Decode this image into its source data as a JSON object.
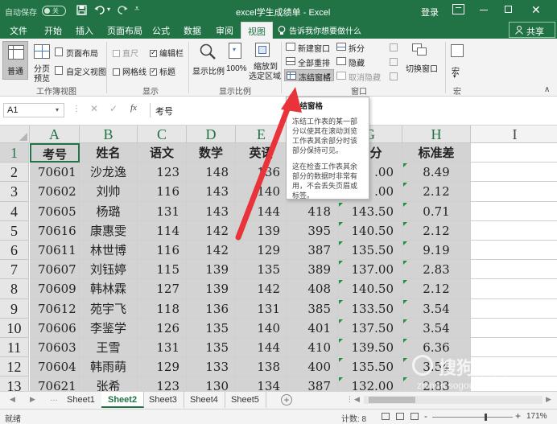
{
  "window": {
    "title": "excel学生成绩单 - Excel",
    "autosave_label": "自动保存",
    "autosave_state": "关",
    "signin_label": "登录"
  },
  "ribbon_tabs": [
    "文件",
    "开始",
    "插入",
    "页面布局",
    "公式",
    "数据",
    "审阅",
    "视图"
  ],
  "tell_me": "告诉我你想要做什么",
  "share_label": "共享",
  "ribbon": {
    "workbook_views": {
      "normal": "普通",
      "page_break_1": "分页",
      "page_break_2": "预览",
      "page_layout": "页面布局",
      "custom_views": "自定义视图",
      "group_label": "工作簿视图"
    },
    "show": {
      "ruler": "直尺",
      "formula_bar": "编辑栏",
      "gridlines": "网格线",
      "headings": "标题",
      "group_label": "显示"
    },
    "zoom": {
      "zoom": "显示比例",
      "hundred": "100%",
      "zoom_sel_1": "缩放到",
      "zoom_sel_2": "选定区域",
      "group_label": "显示比例"
    },
    "window": {
      "new_window": "新建窗口",
      "arrange_all": "全部重排",
      "freeze_panes": "冻结窗格",
      "split": "拆分",
      "hide": "隐藏",
      "unhide": "取消隐藏",
      "switch_1": "切换窗口",
      "group_label": "窗口"
    },
    "macros": {
      "label": "宏",
      "group_label": "宏"
    }
  },
  "formula_bar": {
    "name_box": "A1",
    "fx": "fx",
    "value": "考号"
  },
  "columns": [
    "A",
    "B",
    "C",
    "D",
    "E",
    "F",
    "G",
    "H",
    "I"
  ],
  "rows": [
    "1",
    "2",
    "3",
    "4",
    "5",
    "6",
    "7",
    "8",
    "9",
    "10",
    "11",
    "12",
    "13"
  ],
  "header_row": {
    "A": "考号",
    "B": "姓名",
    "C": "语文",
    "D": "数学",
    "E": "英语",
    "G": "均分",
    "H": "标准差"
  },
  "data_rows": [
    {
      "A": "70601",
      "B": "沙龙逸",
      "C": "123",
      "D": "148",
      "E": "136",
      "F": "",
      "G": ".00",
      "H": "8.49"
    },
    {
      "A": "70602",
      "B": "刘帅",
      "C": "116",
      "D": "143",
      "E": "140",
      "F": "",
      "G": ".00",
      "H": "2.12"
    },
    {
      "A": "70605",
      "B": "杨璐",
      "C": "131",
      "D": "143",
      "E": "144",
      "F": "418",
      "G": "143.50",
      "H": "0.71"
    },
    {
      "A": "70616",
      "B": "康惠雯",
      "C": "114",
      "D": "142",
      "E": "139",
      "F": "395",
      "G": "140.50",
      "H": "2.12"
    },
    {
      "A": "70611",
      "B": "林世博",
      "C": "116",
      "D": "142",
      "E": "129",
      "F": "387",
      "G": "135.50",
      "H": "9.19"
    },
    {
      "A": "70607",
      "B": "刘钰婷",
      "C": "115",
      "D": "139",
      "E": "135",
      "F": "389",
      "G": "137.00",
      "H": "2.83"
    },
    {
      "A": "70609",
      "B": "韩林霖",
      "C": "127",
      "D": "139",
      "E": "142",
      "F": "408",
      "G": "140.50",
      "H": "2.12"
    },
    {
      "A": "70612",
      "B": "苑宇飞",
      "C": "118",
      "D": "136",
      "E": "131",
      "F": "385",
      "G": "133.50",
      "H": "3.54"
    },
    {
      "A": "70606",
      "B": "李鉴学",
      "C": "126",
      "D": "135",
      "E": "140",
      "F": "401",
      "G": "137.50",
      "H": "3.54"
    },
    {
      "A": "70603",
      "B": "王雪",
      "C": "131",
      "D": "135",
      "E": "144",
      "F": "410",
      "G": "139.50",
      "H": "6.36"
    },
    {
      "A": "70604",
      "B": "韩雨萌",
      "C": "129",
      "D": "133",
      "E": "138",
      "F": "400",
      "G": "135.50",
      "H": "3.54"
    },
    {
      "A": "70621",
      "B": "张希",
      "C": "123",
      "D": "130",
      "E": "134",
      "F": "387",
      "G": "132.00",
      "H": "2.83"
    }
  ],
  "tooltip": {
    "title": "冻结窗格",
    "para1": "冻结工作表的某一部分以使其在滚动浏览工作表其余部分时该部分保持可见。",
    "para2": "这在检查工作表其余部分的数据时非常有用，不会丢失页眉或标签。"
  },
  "sheet_tabs": [
    "Sheet1",
    "Sheet2",
    "Sheet3",
    "Sheet4",
    "Sheet5"
  ],
  "active_sheet": "Sheet2",
  "status": {
    "ready": "就绪",
    "count": "计数: 8",
    "zoom_minus": "-",
    "zoom_plus": "+",
    "zoom": "171%"
  },
  "watermark": {
    "brand": "搜狗指南",
    "url": "zhinan.sogou.com"
  },
  "colors": {
    "excel_green": "#217346",
    "selection_gray": "#d3d3d3",
    "arrow_red": "#e8333a"
  }
}
